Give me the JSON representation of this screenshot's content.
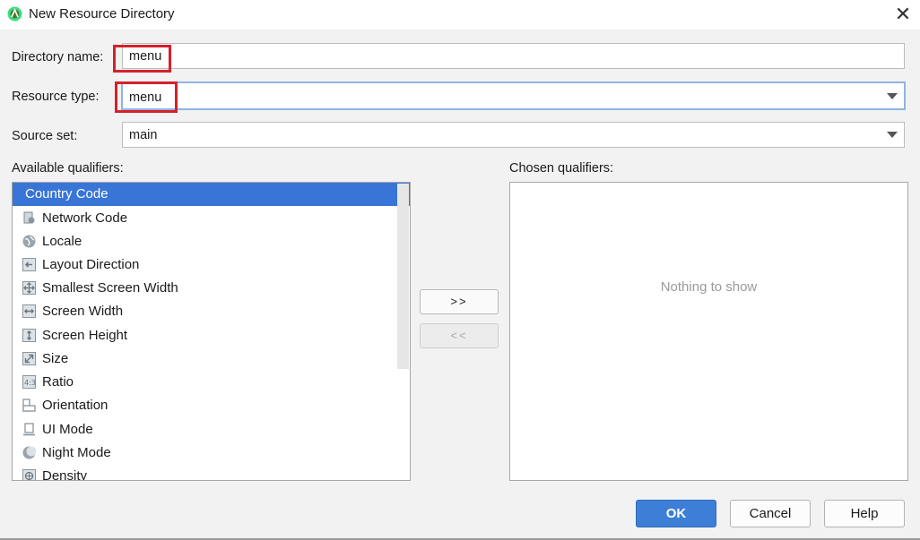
{
  "window": {
    "title": "New Resource Directory",
    "close_glyph": "✕"
  },
  "form": {
    "directory_name_label": "Directory name:",
    "directory_name_value": "menu",
    "resource_type_label": "Resource type:",
    "resource_type_value": "menu",
    "source_set_label": "Source set:",
    "source_set_value": "main"
  },
  "qualifiers": {
    "available_label": "Available qualifiers:",
    "chosen_label": "Chosen qualifiers:",
    "items": [
      {
        "label": "Country Code",
        "icon": "country-code-icon",
        "selected": true
      },
      {
        "label": "Network Code",
        "icon": "network-code-icon"
      },
      {
        "label": "Locale",
        "icon": "globe-icon"
      },
      {
        "label": "Layout Direction",
        "icon": "arrow-left-icon"
      },
      {
        "label": "Smallest Screen Width",
        "icon": "move-arrows-icon"
      },
      {
        "label": "Screen Width",
        "icon": "horizontal-arrows-icon"
      },
      {
        "label": "Screen Height",
        "icon": "vertical-arrows-icon"
      },
      {
        "label": "Size",
        "icon": "diagonal-resize-icon"
      },
      {
        "label": "Ratio",
        "icon": "ratio-icon"
      },
      {
        "label": "Orientation",
        "icon": "orientation-icon"
      },
      {
        "label": "UI Mode",
        "icon": "ui-mode-icon"
      },
      {
        "label": "Night Mode",
        "icon": "night-mode-icon"
      },
      {
        "label": "Density",
        "icon": "density-icon"
      }
    ],
    "add_button": ">>",
    "remove_button": "<<",
    "empty_text": "Nothing to show"
  },
  "buttons": {
    "ok": "OK",
    "cancel": "Cancel",
    "help": "Help"
  },
  "colors": {
    "selection": "#3875d7",
    "primary_button": "#3d7ed6",
    "highlight_box": "#d6202a"
  }
}
